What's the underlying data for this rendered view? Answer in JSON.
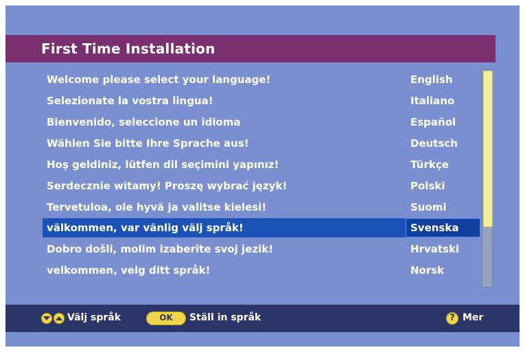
{
  "title": "First Time Installation",
  "languages": [
    {
      "message": "Welcome please select your language!",
      "language": "English"
    },
    {
      "message": "Selezionate la vostra lingua!",
      "language": "Italiano"
    },
    {
      "message": "Bienvenido, seleccione un idioma",
      "language": "Español"
    },
    {
      "message": "Wählen Sie bitte Ihre Sprache aus!",
      "language": "Deutsch"
    },
    {
      "message": "Hoş geldiniz, lütfen dil seçimini yapınız!",
      "language": "Türkçe"
    },
    {
      "message": "Serdecznie witamy! Proszę wybrać język!",
      "language": "Polski"
    },
    {
      "message": "Tervetuloa, ole hyvä ja valitse kielesi!",
      "language": "Suomi"
    },
    {
      "message": "välkommen, var vänlig välj språk!",
      "language": "Svenska"
    },
    {
      "message": "Dobro došli, molim izaberite svoj jezik!",
      "language": "Hrvatski"
    },
    {
      "message": "velkommen, velg ditt språk!",
      "language": "Norsk"
    }
  ],
  "selected_language": "Svenska",
  "scroll_position_fraction": 0.72,
  "footer": {
    "select_label": "Välj språk",
    "ok_button": "OK",
    "ok_label": "Ställ in språk",
    "help_icon": "?",
    "more_label": "Mer"
  },
  "colors": {
    "background": "#7a8fd0",
    "title_bar": "#7a2f6f",
    "selected_row": "#1a52b8",
    "footer": "#2c3568",
    "button_yellow": "#f1d64a",
    "scroll_thumb": "#f3f09a"
  }
}
